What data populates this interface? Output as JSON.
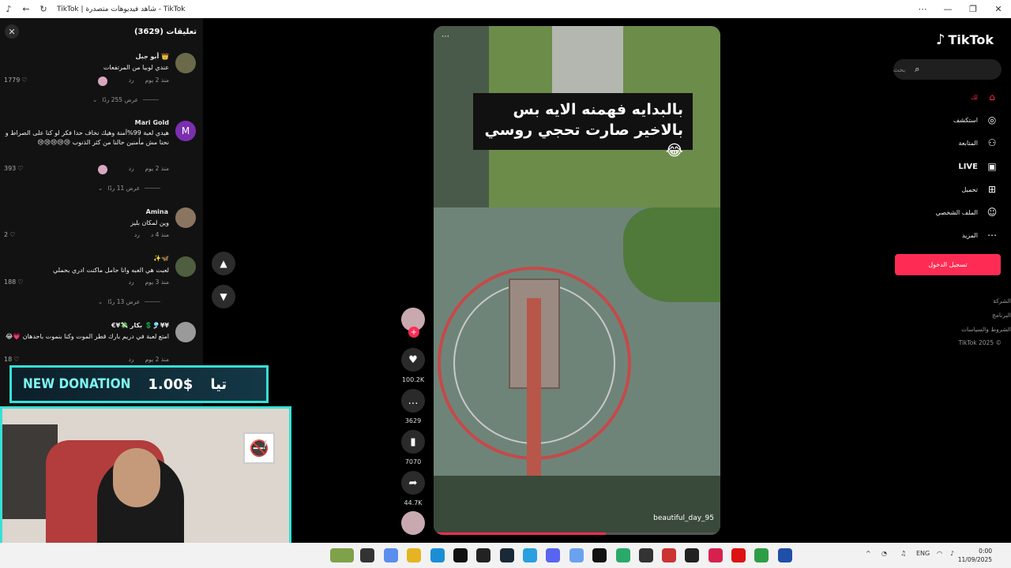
{
  "window": {
    "title": "TikTok | شاهد فيديوهات متصدرة - TikTok",
    "min": "—",
    "restore": "❐",
    "close": "✕",
    "more": "⋯"
  },
  "comments": {
    "title": "تعليقات (3629)",
    "items": [
      {
        "user": "أبو جبل 👑",
        "text": "عندي لوبيا من المرتفعات",
        "time": "منذ 2 يوم",
        "reply": "رد",
        "likes": "1779",
        "replies": "عرض 255 ردًا"
      },
      {
        "user": "Mari Gold",
        "avatar": "M",
        "text": "هيدي لعبة 99%آمنة وهيك نخاف حدا فكر لو كنا على الصراط و نحنا مش مأمنين حالنا من كثر الذنوب 😢😢😢😢😢",
        "time": "منذ 2 يوم",
        "reply": "رد",
        "likes": "393",
        "replies": "عرض 11 ردًا"
      },
      {
        "user": "Amina",
        "text": "وين لمكان بليز",
        "time": "منذ 4 د",
        "reply": "رد",
        "likes": "2"
      },
      {
        "user": "✨🦋",
        "text": "لعبت هي العبه وانا حامل ماكنت ادري بحملي",
        "time": "منذ 3 يوم",
        "reply": "رد",
        "likes": "188",
        "replies": "عرض 13 ردًا"
      },
      {
        "user": "€¥💸 بكار 💲🎐¥¥",
        "text": "امتع لعبة في دريم بارك قطر الموت وكنا بنموت باحدهان 💗😂",
        "time": "منذ 2 يوم",
        "reply": "رد",
        "likes": "18"
      }
    ]
  },
  "video": {
    "caption": "بالبدايه فهمنه الايه بس بالاخير صارت تحجي روسي 😂",
    "handle": "beautiful_day_95",
    "progress": 0.6,
    "more_dots": "⋯"
  },
  "actions": {
    "follow_plus": "+",
    "likes": "100.2K",
    "comments": "3629",
    "saves": "7070",
    "shares": "44.7K"
  },
  "sidebar": {
    "logo": "TikTok",
    "search_placeholder": "بحث",
    "nav": [
      {
        "label": "لك",
        "icon": "home-icon"
      },
      {
        "label": "استكشف",
        "icon": "compass-icon"
      },
      {
        "label": "المتابعة",
        "icon": "follow-icon"
      },
      {
        "label": "LIVE",
        "icon": "live-icon"
      },
      {
        "label": "تحميل",
        "icon": "upload-icon"
      },
      {
        "label": "الملف الشخصي",
        "icon": "profile-icon"
      },
      {
        "label": "المزيد",
        "icon": "more-icon"
      }
    ],
    "login": "تسجيل الدخول",
    "footer": [
      "الشركة",
      "البرنامج",
      "الشروط والسياسات",
      "© 2025 TikTok"
    ]
  },
  "overlay": {
    "donation_title": "NEW DONATION",
    "donation_amount": "1.00$",
    "donation_name": "تيا",
    "sign_icon": "🚭"
  },
  "taskbar": {
    "lang": "ENG",
    "time": "0:00",
    "date": "11/09/2025",
    "tray_up": "^"
  },
  "colors": {
    "accent": "#fe2c55",
    "overlay": "#36e0d6"
  }
}
